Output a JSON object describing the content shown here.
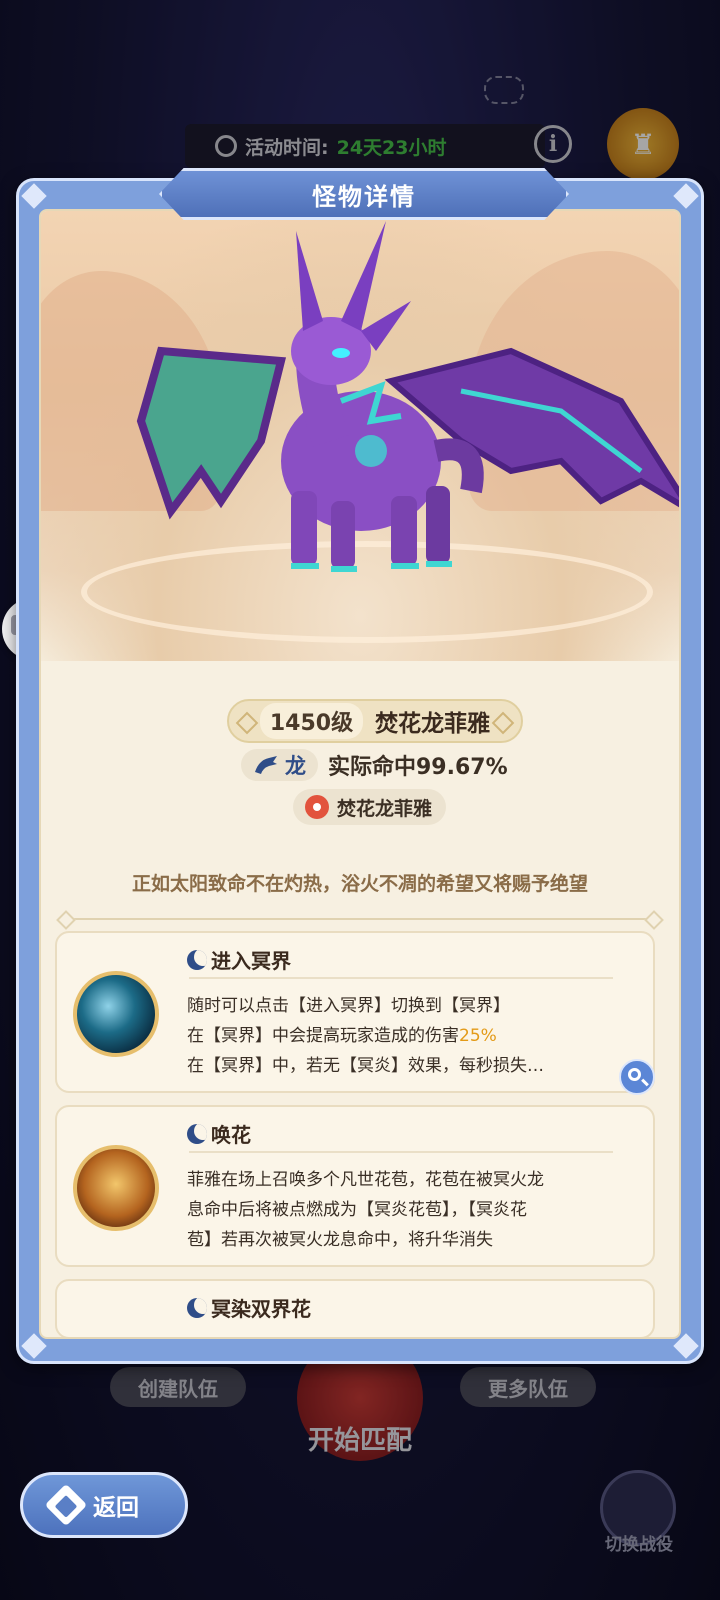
{
  "background": {
    "activity_label": "活动时间:",
    "activity_value": "24天23小时",
    "create_team": "创建队伍",
    "more_teams": "更多队伍",
    "start_match": "开始匹配",
    "switch_battle": "切换战役"
  },
  "modal": {
    "title": "怪物详情"
  },
  "monster": {
    "level": "1450级",
    "name": "焚花龙菲雅",
    "type": "龙",
    "hit_rate": "实际命中99.67%",
    "location": "焚花龙菲雅",
    "flavor": "正如太阳致命不在灼热，浴火不凋的希望又将赐予绝望"
  },
  "skills": [
    {
      "name": "进入冥界",
      "line1": "随时可以点击【进入冥界】切换到【冥界】",
      "line2_pre": "在【冥界】中会提高玩家造成的伤害",
      "line2_hl": "25%",
      "line3": "在【冥界】中，若无【冥炎】效果，每秒损失…"
    },
    {
      "name": "唤花",
      "line1": "菲雅在场上召唤多个凡世花苞，花苞在被冥火龙",
      "line2": "息命中后将被点燃成为【冥炎花苞】，【冥炎花",
      "line3": "苞】若再次被冥火龙息命中，将升华消失"
    },
    {
      "name": "冥染双界花"
    }
  ],
  "back_button": "返回",
  "colors": {
    "frame_blue": "#7ea0dc",
    "panel_cream": "#f7f0e1",
    "highlight": "#e39a17",
    "timer_green": "#47c14a"
  }
}
